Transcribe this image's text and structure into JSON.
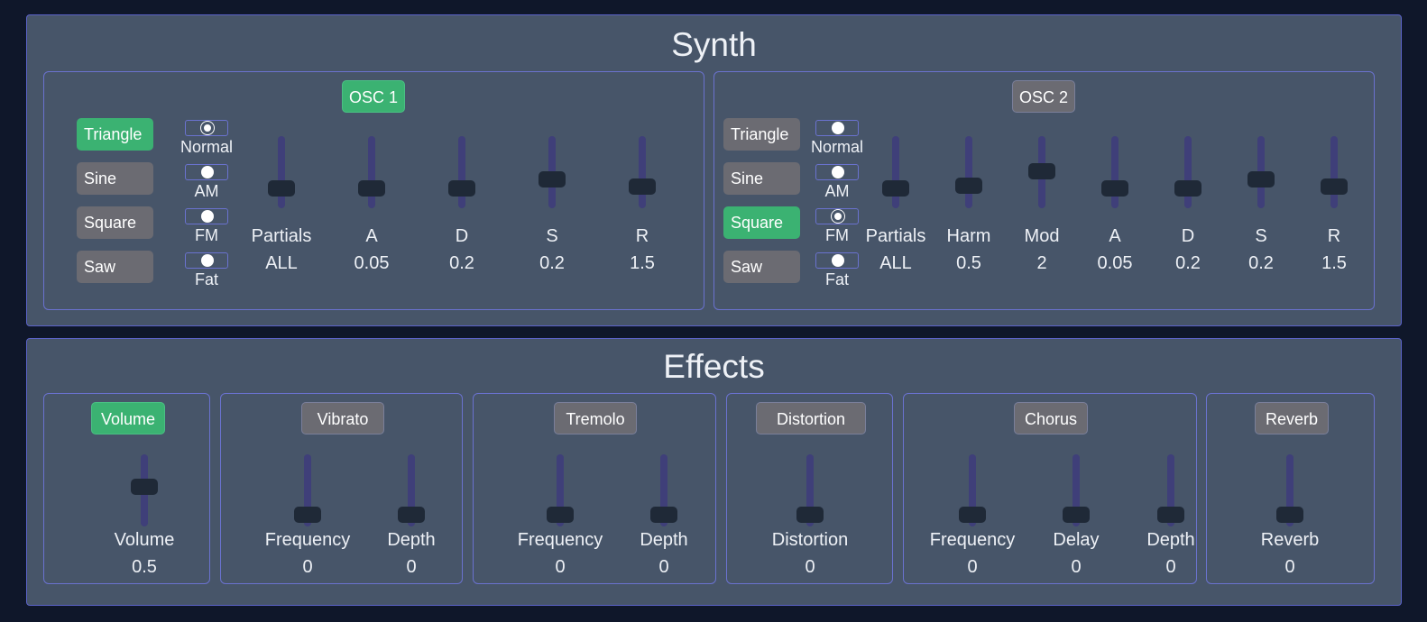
{
  "synth": {
    "title": "Synth",
    "osc1": {
      "label": "OSC 1",
      "waves": [
        "Triangle",
        "Sine",
        "Square",
        "Saw"
      ],
      "active_wave": 0,
      "modes": [
        "Normal",
        "AM",
        "FM",
        "Fat"
      ],
      "checked_mode": 0,
      "params": [
        {
          "label": "Partials",
          "value": "ALL",
          "level": 0.15
        },
        {
          "label": "A",
          "value": "0.05",
          "level": 0.15
        },
        {
          "label": "D",
          "value": "0.2",
          "level": 0.15
        },
        {
          "label": "S",
          "value": "0.2",
          "level": 0.3
        },
        {
          "label": "R",
          "value": "1.5",
          "level": 0.18
        }
      ]
    },
    "osc2": {
      "label": "OSC 2",
      "waves": [
        "Triangle",
        "Sine",
        "Square",
        "Saw"
      ],
      "active_wave": 2,
      "modes": [
        "Normal",
        "AM",
        "FM",
        "Fat"
      ],
      "checked_mode": 2,
      "params": [
        {
          "label": "Partials",
          "value": "ALL",
          "level": 0.15
        },
        {
          "label": "Harm",
          "value": "0.5",
          "level": 0.2
        },
        {
          "label": "Mod",
          "value": "2",
          "level": 0.45
        },
        {
          "label": "A",
          "value": "0.05",
          "level": 0.15
        },
        {
          "label": "D",
          "value": "0.2",
          "level": 0.15
        },
        {
          "label": "S",
          "value": "0.2",
          "level": 0.3
        },
        {
          "label": "R",
          "value": "1.5",
          "level": 0.18
        }
      ]
    }
  },
  "effects": {
    "title": "Effects",
    "groups": [
      {
        "label": "Volume",
        "active": true,
        "params": [
          {
            "label": "Volume",
            "value": "0.5",
            "level": 0.5
          }
        ]
      },
      {
        "label": "Vibrato",
        "active": false,
        "params": [
          {
            "label": "Frequency",
            "value": "0",
            "level": 0
          },
          {
            "label": "Depth",
            "value": "0",
            "level": 0
          }
        ]
      },
      {
        "label": "Tremolo",
        "active": false,
        "params": [
          {
            "label": "Frequency",
            "value": "0",
            "level": 0
          },
          {
            "label": "Depth",
            "value": "0",
            "level": 0
          }
        ]
      },
      {
        "label": "Distortion",
        "active": false,
        "params": [
          {
            "label": "Distortion",
            "value": "0",
            "level": 0
          }
        ]
      },
      {
        "label": "Chorus",
        "active": false,
        "params": [
          {
            "label": "Frequency",
            "value": "0",
            "level": 0
          },
          {
            "label": "Delay",
            "value": "0",
            "level": 0
          },
          {
            "label": "Depth",
            "value": "0",
            "level": 0
          }
        ]
      },
      {
        "label": "Reverb",
        "active": false,
        "params": [
          {
            "label": "Reverb",
            "value": "0",
            "level": 0
          }
        ]
      }
    ]
  },
  "colors": {
    "accent": "#3bb272",
    "panel": "#475569",
    "background": "#0f172a",
    "border": "#5b63c9"
  }
}
